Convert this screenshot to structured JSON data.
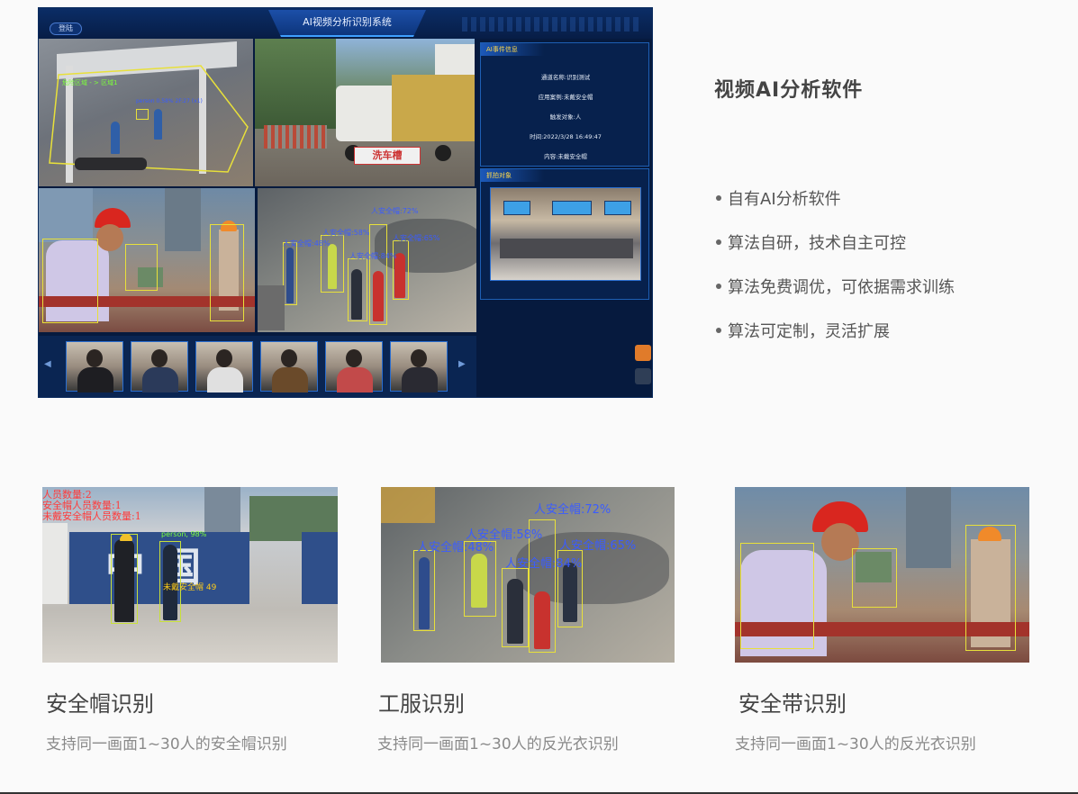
{
  "dashboard": {
    "title": "AI视频分析识别系统",
    "back_label": "登陆",
    "event_panel": {
      "header": "AI事件信息",
      "channel": "通道名称:识别测试",
      "scene": "应用案例:未戴安全帽",
      "trigger": "触发对象:人",
      "time": "时间:2022/3/28 16:49:47",
      "content": "内容:未戴安全帽"
    },
    "capture_panel": {
      "header": "抓拍对象"
    },
    "camera_labels": {
      "zone": "危险区域 - > 区域1",
      "c1_person": "person 0.58% 2F:27 (x1)",
      "c4_a": "人安全帽:72%",
      "c4_b": "人安全帽:58%",
      "c4_c": "人安全帽:48%",
      "c4_d": "人安全帽:84%",
      "c4_e": "人安全帽:65%"
    },
    "car_sign": "洗车槽"
  },
  "main": {
    "heading": "视频AI分析软件",
    "features": [
      "自有AI分析软件",
      "算法自研，技术自主可控",
      "算法免费调优，可依据需求训练",
      "算法可定制，灵活扩展"
    ]
  },
  "cards": [
    {
      "title": "安全帽识别",
      "desc": "支持同一画面1~30人的安全帽识别",
      "overlay": [
        "人员数量:2",
        "安全帽人员数量:1",
        "未戴安全帽人员数量:1"
      ],
      "box_labels": [
        "person, 98%",
        "未戴安全帽 49"
      ],
      "wall_text": "中国"
    },
    {
      "title": "工服识别",
      "desc": "支持同一画面1~30人的反光衣识别",
      "box_labels": [
        "人安全帽:72%",
        "人安全帽:58%",
        "人安全帽:48%",
        "人安全帽:84%",
        "人安全帽:65%"
      ]
    },
    {
      "title": "安全带识别",
      "desc": "支持同一画面1~30人的反光衣识别"
    }
  ],
  "colors": {
    "detect_box": "#e8e03a",
    "detect_label": "#3a5cff",
    "warn_text": "#ff3b3b",
    "dashboard_bg": "#061a3e"
  }
}
